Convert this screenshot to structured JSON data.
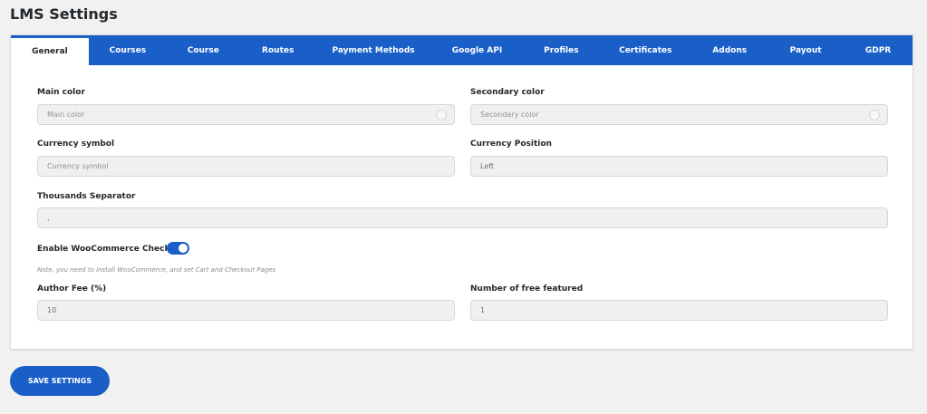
{
  "page": {
    "title": "LMS Settings"
  },
  "tabs": [
    {
      "label": "General",
      "active": true
    },
    {
      "label": "Courses"
    },
    {
      "label": "Course"
    },
    {
      "label": "Routes"
    },
    {
      "label": "Payment Methods"
    },
    {
      "label": "Google API"
    },
    {
      "label": "Profiles"
    },
    {
      "label": "Certificates"
    },
    {
      "label": "Addons"
    },
    {
      "label": "Payout"
    },
    {
      "label": "GDPR"
    }
  ],
  "fields": {
    "main_color": {
      "label": "Main color",
      "placeholder": "Main color"
    },
    "secondary_color": {
      "label": "Secondary color",
      "placeholder": "Secondary color"
    },
    "currency_symbol": {
      "label": "Currency symbol",
      "placeholder": "Currency symbol"
    },
    "currency_position": {
      "label": "Currency Position",
      "value": "Left"
    },
    "thousands_separator": {
      "label": "Thousands Separator",
      "value": ","
    },
    "woocommerce": {
      "label": "Enable WooCommerce Checkout",
      "enabled": true,
      "note": "Note, you need to install WooCommerce, and set Cart and Checkout Pages"
    },
    "author_fee": {
      "label": "Author Fee (%)",
      "value": "10"
    },
    "free_featured": {
      "label": "Number of free featured",
      "value": "1"
    }
  },
  "actions": {
    "save_label": "SAVE SETTINGS"
  },
  "colors": {
    "accent": "#1a5fc8",
    "background": "#f1f1f1",
    "input_bg": "#f0f0f1"
  }
}
